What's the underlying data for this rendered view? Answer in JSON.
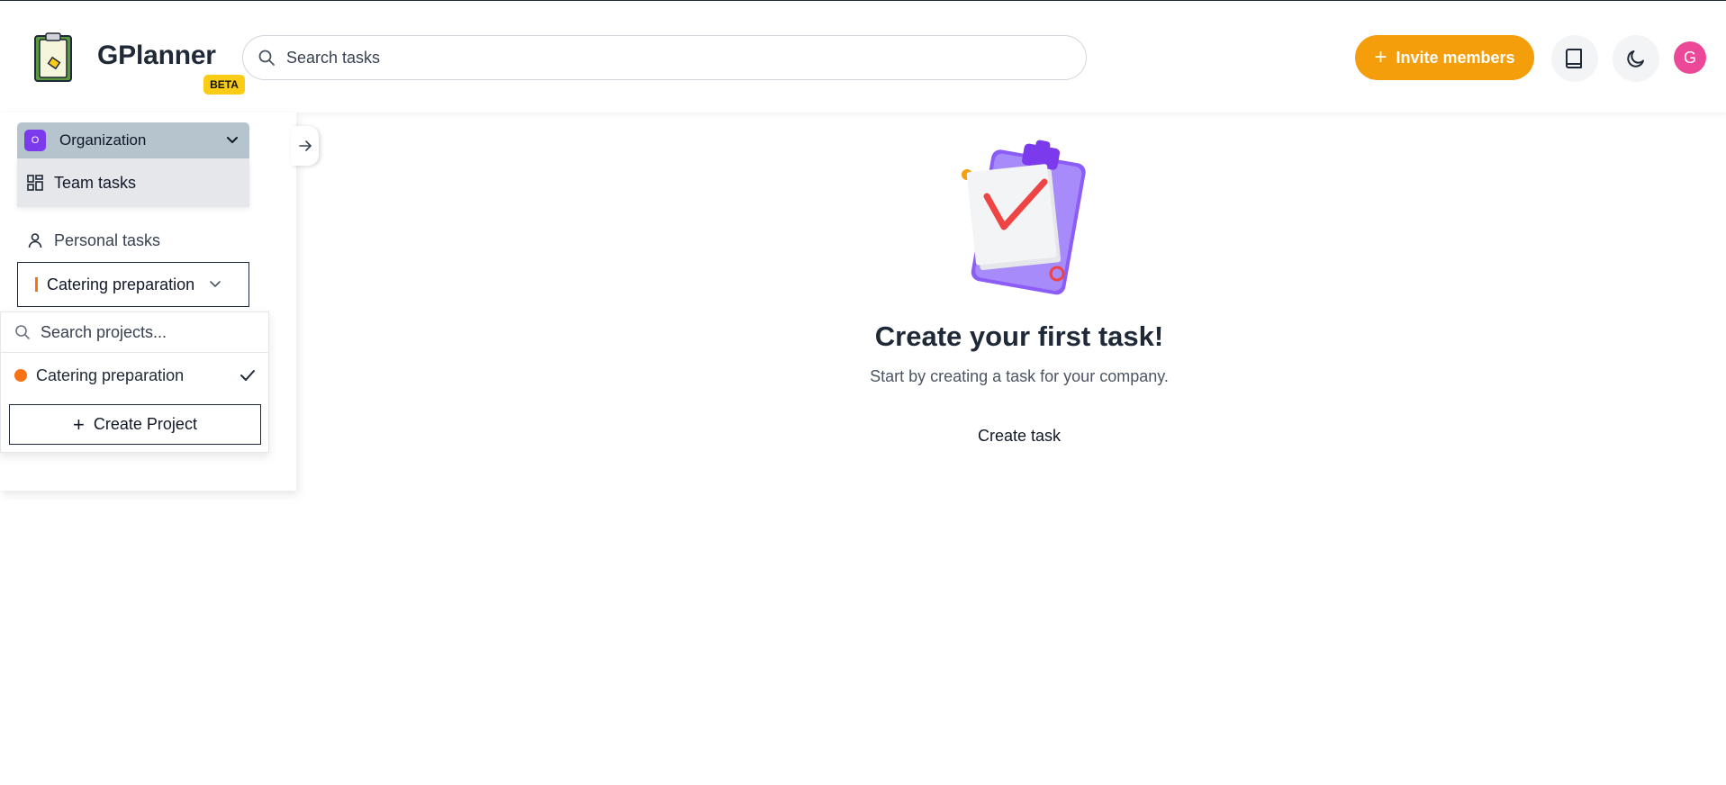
{
  "header": {
    "brand": "GPlanner",
    "beta_badge": "BETA",
    "search_placeholder": "Search tasks",
    "invite_label": "Invite members",
    "avatar_initial": "G"
  },
  "sidebar": {
    "organization": {
      "badge": "O",
      "label": "Organization"
    },
    "items": [
      {
        "label": "Team tasks",
        "icon": "grid-icon",
        "active": true
      },
      {
        "label": "Personal tasks",
        "icon": "user-icon",
        "active": false
      }
    ],
    "project_select": {
      "label": "Catering preparation",
      "color": "#f97316"
    }
  },
  "project_dropdown": {
    "search_placeholder": "Search projects...",
    "projects": [
      {
        "label": "Catering preparation",
        "color": "#f97316",
        "selected": true
      }
    ],
    "create_label": "Create Project"
  },
  "main": {
    "empty_title": "Create your first task!",
    "empty_subtitle": "Start by creating a task for your company.",
    "create_task_label": "Create task"
  },
  "colors": {
    "accent": "#f59e0b",
    "avatar": "#ec4899",
    "org_badge": "#7c3aed",
    "project": "#f97316"
  }
}
